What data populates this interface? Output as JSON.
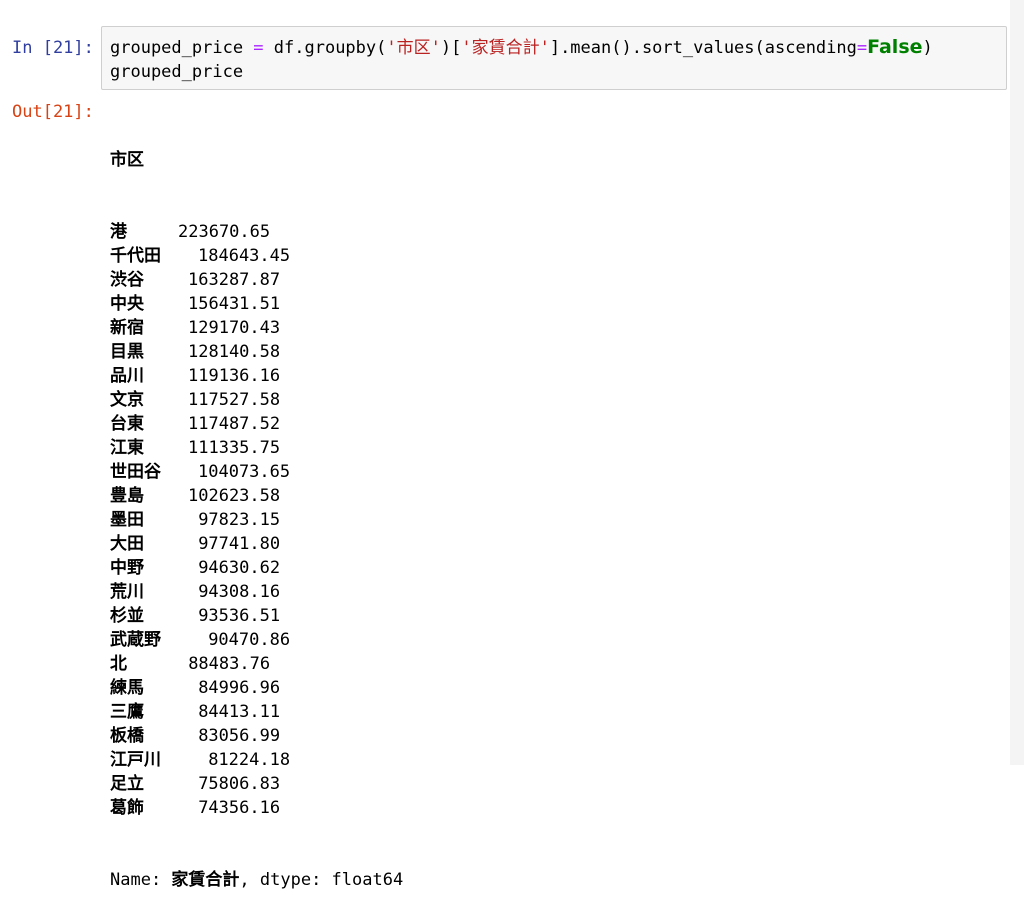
{
  "cell": {
    "in_prompt": "In [21]:",
    "out_prompt": "Out[21]:",
    "code": {
      "line1": {
        "a": "grouped_price ",
        "eq": "=",
        "b": " df.groupby(",
        "s1": "'市区'",
        "c": ")[",
        "s2": "'家賃合計'",
        "d": "].mean().sort_values(ascending",
        "eq2": "=",
        "kw": "False",
        "e": ")"
      },
      "line2": "grouped_price"
    }
  },
  "output": {
    "index_name": "市区",
    "rows": [
      {
        "label": "港",
        "value": "223670.65"
      },
      {
        "label": "千代田",
        "value": "184643.45"
      },
      {
        "label": "渋谷",
        "value": "163287.87"
      },
      {
        "label": "中央",
        "value": "156431.51"
      },
      {
        "label": "新宿",
        "value": "129170.43"
      },
      {
        "label": "目黒",
        "value": "128140.58"
      },
      {
        "label": "品川",
        "value": "119136.16"
      },
      {
        "label": "文京",
        "value": "117527.58"
      },
      {
        "label": "台東",
        "value": "117487.52"
      },
      {
        "label": "江東",
        "value": "111335.75"
      },
      {
        "label": "世田谷",
        "value": "104073.65"
      },
      {
        "label": "豊島",
        "value": "102623.58"
      },
      {
        "label": "墨田",
        "value": "97823.15"
      },
      {
        "label": "大田",
        "value": "97741.80"
      },
      {
        "label": "中野",
        "value": "94630.62"
      },
      {
        "label": "荒川",
        "value": "94308.16"
      },
      {
        "label": "杉並",
        "value": "93536.51"
      },
      {
        "label": "武蔵野",
        "value": "90470.86"
      },
      {
        "label": "北",
        "value": "88483.76"
      },
      {
        "label": "練馬",
        "value": "84996.96"
      },
      {
        "label": "三鷹",
        "value": "84413.11"
      },
      {
        "label": "板橋",
        "value": "83056.99"
      },
      {
        "label": "江戸川",
        "value": "81224.18"
      },
      {
        "label": "足立",
        "value": "75806.83"
      },
      {
        "label": "葛飾",
        "value": "74356.16"
      }
    ],
    "footer": {
      "name_prefix": "Name: ",
      "name_value": "家賃合計",
      "dtype_text": ", dtype: float64"
    }
  }
}
